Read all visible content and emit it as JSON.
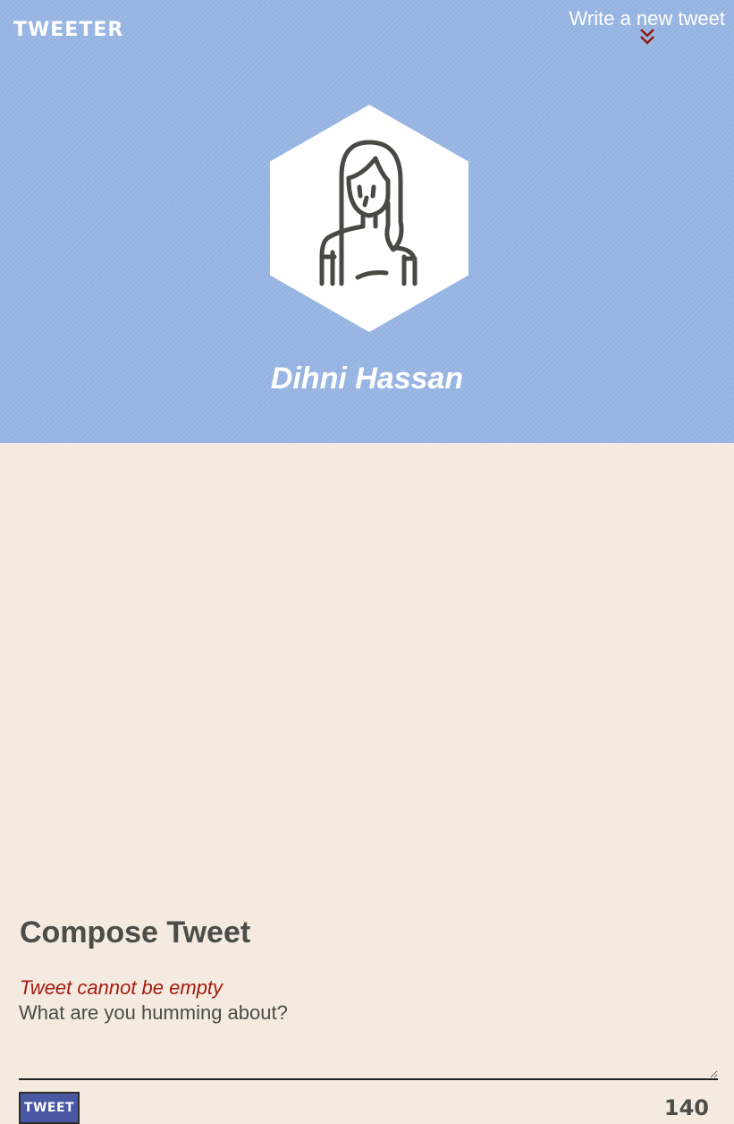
{
  "nav": {
    "brand": "TWEETER",
    "write_link": "Write a new tweet",
    "toggle_icon": "double-chevron-down-icon",
    "accent": "#8c1d14"
  },
  "profile": {
    "avatar_icon": "woman-avatar-icon",
    "name": "Dihni Hassan"
  },
  "compose": {
    "title": "Compose Tweet",
    "error": "Tweet cannot be empty",
    "placeholder": "What are you humming about?",
    "value": "",
    "button_label": "TWEET",
    "counter": "140"
  },
  "colors": {
    "header_bg": "#98b6e4",
    "page_bg": "#f4eadf",
    "error": "#a31b12",
    "button_bg": "#4a57a3"
  }
}
